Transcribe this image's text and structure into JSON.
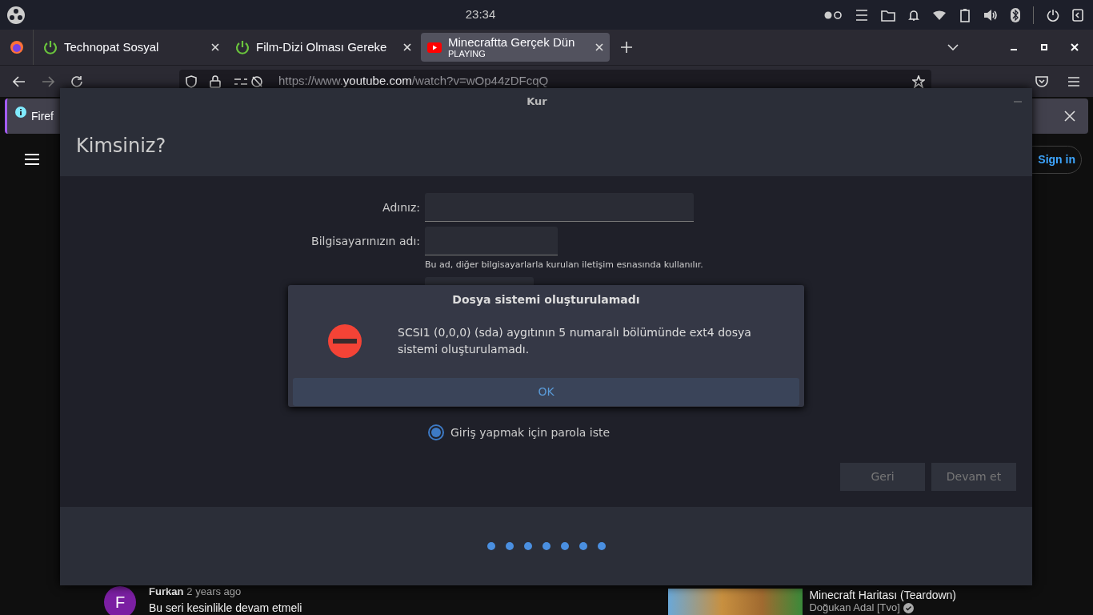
{
  "top_panel": {
    "clock": "23:34"
  },
  "browser": {
    "tabs": [
      {
        "title": "Technopat Sosyal",
        "kind": "power",
        "selected": false
      },
      {
        "title": "Film-Dizi Olması Gereke",
        "kind": "power",
        "selected": false
      },
      {
        "title": "Minecraftta Gerçek Dün",
        "kind": "video",
        "status": "PLAYING",
        "selected": true
      }
    ],
    "url": {
      "prefix": "https://www.",
      "domain": "youtube.com",
      "path": "/watch?v=wOp44zDFcqQ"
    },
    "notification": {
      "text": "Firef"
    }
  },
  "youtube": {
    "sign_in": "Sign in",
    "comment": {
      "avatar_letter": "F",
      "author": "Furkan",
      "time": "2 years ago",
      "text": "Bu seri kesinlikle devam etmeli"
    },
    "video": {
      "title": "Minecraft Haritası (Teardown)",
      "channel": "Doğukan Adal [Tvo]"
    }
  },
  "installer": {
    "title": "Kur",
    "heading": "Kimsiniz?",
    "fields": [
      {
        "label": "Adınız:"
      },
      {
        "label": "Bilgisayarınızın adı:",
        "hint": "Bu ad, diğer bilgisayarlarla kurulan iletişim esnasında kullanılır."
      }
    ],
    "radio": {
      "label": "Giriş yapmak için parola iste",
      "selected": true
    },
    "buttons": [
      {
        "label": "Geri",
        "disabled": true
      },
      {
        "label": "Devam et",
        "disabled": true
      }
    ]
  },
  "error_dialog": {
    "title": "Dosya sistemi oluşturulamadı",
    "message": "SCSI1 (0,0,0) (sda) aygıtının 5 numaralı bölümünde ext4 dosya sistemi oluşturulamadı.",
    "button": "OK"
  }
}
